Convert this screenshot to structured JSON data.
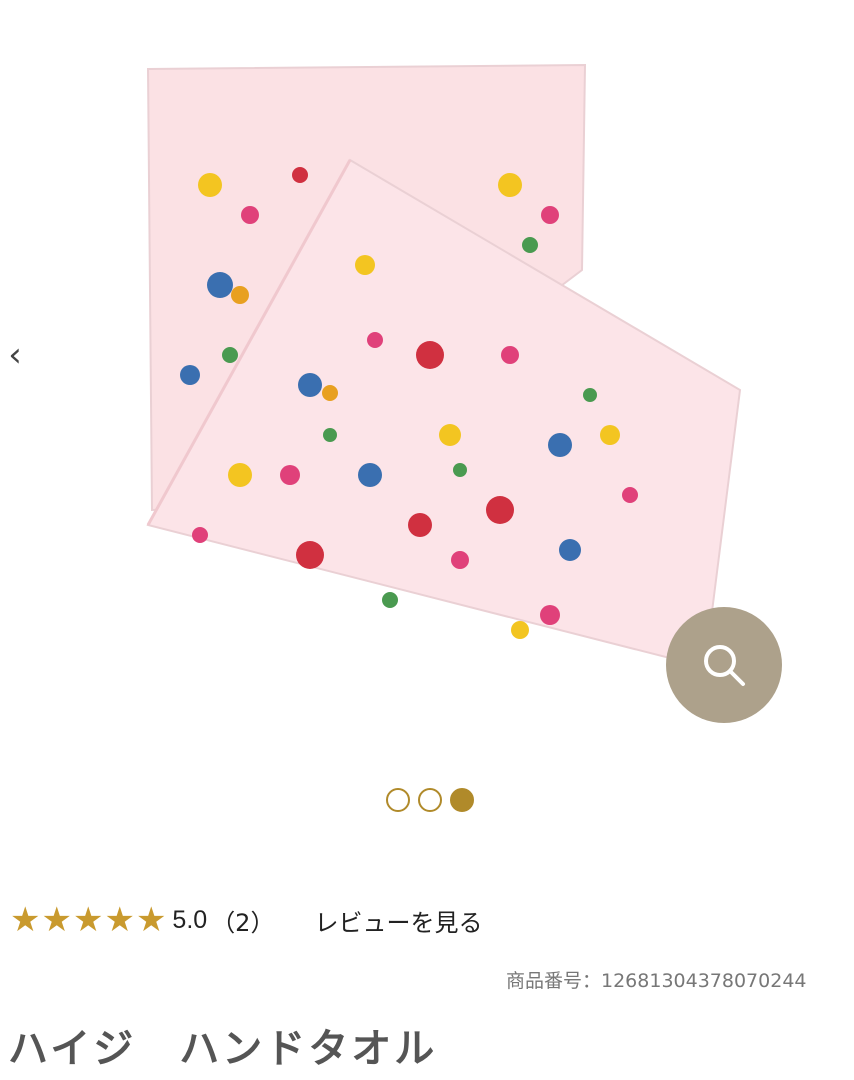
{
  "gallery": {
    "prev_arrow": "‹",
    "zoom_icon": "search-icon",
    "zoom_color": "#ada18b",
    "towel_color": "#fbe1e4",
    "slide_count": 3,
    "active_slide": 3
  },
  "review": {
    "stars": "★★★★★",
    "star_count": 5,
    "star_color": "#c99a2e",
    "score": "5.0",
    "count": "（2）",
    "link_label": "レビューを見る"
  },
  "product": {
    "number": "商品番号：12681304378070244",
    "title": "ハイジ　ハンドタオル"
  },
  "colors": {
    "accent": "#b08a2a"
  }
}
